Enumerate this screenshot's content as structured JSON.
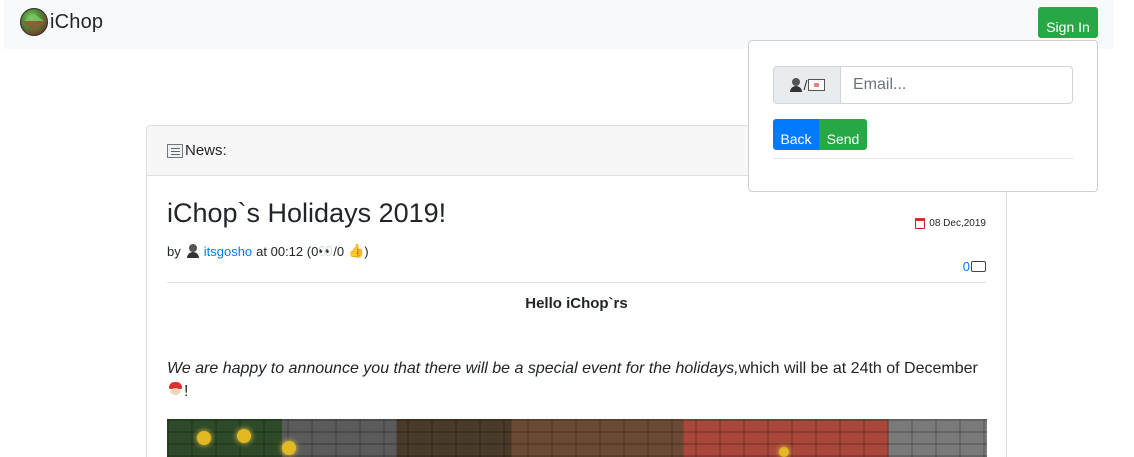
{
  "navbar": {
    "brand_name": "iChop",
    "signin_label": "Sign In"
  },
  "news": {
    "header_label": "News:",
    "title": "iChop`s Holidays 2019!",
    "date": "08 Dec,2019",
    "meta": {
      "by": "by",
      "author": "itsgosho",
      "at": "at 00:12 (0",
      "views": "/0",
      "close": ")"
    },
    "comment_count": "0",
    "greeting": "Hello iChop`rs",
    "body_italic": "We are happy to announce you that there will be a special event for the holidays,",
    "body_normal": "which will be at 24th of December",
    "body_end": "!"
  },
  "login": {
    "email_placeholder": "Email...",
    "back_label": "Back",
    "send_label": "Send"
  },
  "colors": {
    "success": "#28a745",
    "primary": "#007bff"
  }
}
